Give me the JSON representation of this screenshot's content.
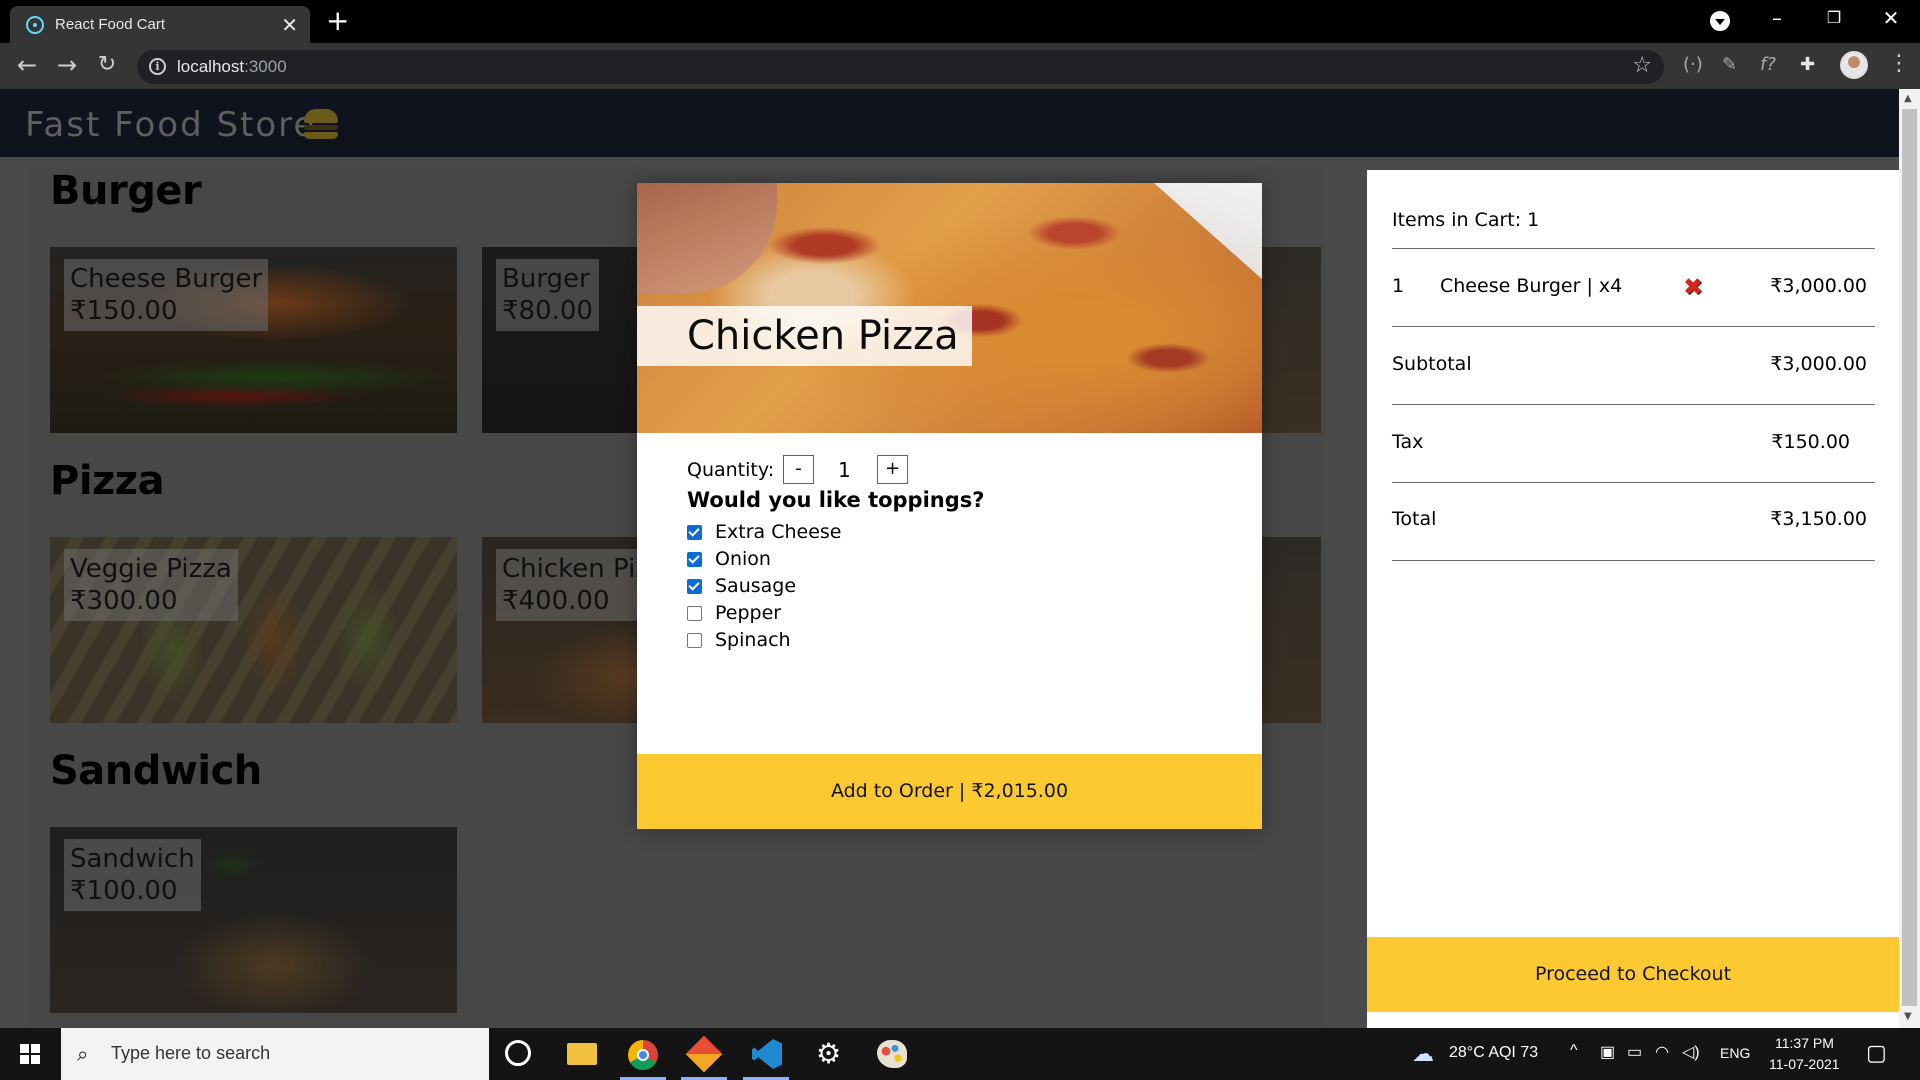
{
  "browser": {
    "tab_title": "React Food Cart",
    "url_host": "localhost",
    "url_port": ":3000"
  },
  "header": {
    "logo_text": "Fast Food Store"
  },
  "menu": {
    "categories": [
      {
        "name": "Burger"
      },
      {
        "name": "Pizza"
      },
      {
        "name": "Sandwich"
      }
    ],
    "items": [
      {
        "name": "Cheese Burger",
        "price": "₹150.00"
      },
      {
        "name": "Burger",
        "price": "₹80.00"
      },
      {
        "name": "Veggie Pizza",
        "price": "₹300.00"
      },
      {
        "name": "Chicken Pizza",
        "price": "₹400.00"
      },
      {
        "name": "Sandwich",
        "price": "₹100.00"
      }
    ]
  },
  "modal": {
    "title": "Chicken Pizza",
    "quantity_label": "Quantity:",
    "decrement_label": "-",
    "increment_label": "+",
    "quantity": "1",
    "toppings_title": "Would you like toppings?",
    "toppings": [
      {
        "label": "Extra Cheese",
        "checked": true
      },
      {
        "label": "Onion",
        "checked": true
      },
      {
        "label": "Sausage",
        "checked": true
      },
      {
        "label": "Pepper",
        "checked": false
      },
      {
        "label": "Spinach",
        "checked": false
      }
    ],
    "add_button": "Add to Order | ₹2,015.00"
  },
  "cart": {
    "count_text": "Items in Cart: 1",
    "items": [
      {
        "index": "1",
        "name": "Cheese Burger | x4",
        "price": "₹3,000.00"
      }
    ],
    "subtotal_label": "Subtotal",
    "subtotal": "₹3,000.00",
    "tax_label": "Tax",
    "tax": "₹150.00",
    "total_label": "Total",
    "total": "₹3,150.00",
    "checkout_button": "Proceed to Checkout"
  },
  "taskbar": {
    "search_placeholder": "Type here to search",
    "weather": "28°C  AQI 73",
    "language": "ENG",
    "time": "11:37 PM",
    "date": "11-07-2021"
  },
  "colors": {
    "accent_yellow": "#fdc931",
    "header_bg": "#0f131d",
    "overlay": "#494949",
    "remove_red": "#d3271c",
    "checkbox_blue": "#0b6bd8"
  },
  "icons": [
    "react-icon",
    "close-icon",
    "plus-icon",
    "back-icon",
    "forward-icon",
    "reload-icon",
    "info-icon",
    "star-icon",
    "extension-icon",
    "burger-icon",
    "remove-icon",
    "windows-icon",
    "search-icon",
    "cortana-icon",
    "file-explorer-icon",
    "chrome-icon",
    "git-icon",
    "vscode-icon",
    "settings-icon",
    "paint-icon",
    "cloud-icon",
    "notification-icon"
  ]
}
